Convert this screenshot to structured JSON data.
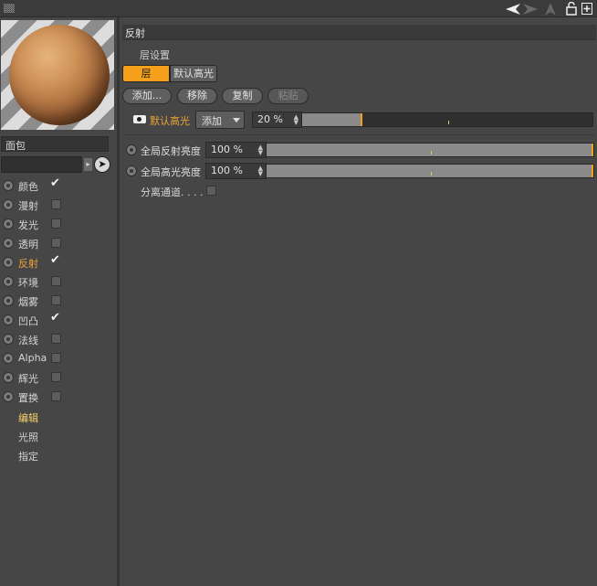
{
  "topbar": {
    "icons": [
      "grip-icon",
      "back-arrow-icon",
      "forward-arrow-icon",
      "up-arrow-icon",
      "lock-icon",
      "new-panel-icon"
    ]
  },
  "left_panel": {
    "material_name": "面包",
    "channels": [
      {
        "label": "颜色",
        "checked": true,
        "active": false
      },
      {
        "label": "漫射",
        "checked": false,
        "active": false
      },
      {
        "label": "发光",
        "checked": false,
        "active": false
      },
      {
        "label": "透明",
        "checked": false,
        "active": false
      },
      {
        "label": "反射",
        "checked": true,
        "active": true
      },
      {
        "label": "环境",
        "checked": false,
        "active": false
      },
      {
        "label": "烟雾",
        "checked": false,
        "active": false
      },
      {
        "label": "凹凸",
        "checked": true,
        "active": false
      },
      {
        "label": "法线",
        "checked": false,
        "active": false
      },
      {
        "label": "Alpha",
        "checked": false,
        "active": false
      },
      {
        "label": "辉光",
        "checked": false,
        "active": false
      },
      {
        "label": "置换",
        "checked": false,
        "active": false
      }
    ],
    "extras": [
      {
        "label": "编辑",
        "highlight": true
      },
      {
        "label": "光照",
        "highlight": false
      },
      {
        "label": "指定",
        "highlight": false
      }
    ],
    "check_mark": "✔"
  },
  "right_panel": {
    "section_title": "反射",
    "layer_settings_label": "层设置",
    "tabs": {
      "active": "层",
      "inactive": "默认高光"
    },
    "buttons": {
      "add": "添加...",
      "remove": "移除",
      "copy": "复制",
      "paste": "粘贴"
    },
    "layer": {
      "name": "默认高光",
      "blend_mode": "添加",
      "opacity": "20 %",
      "opacity_fraction": 0.2
    },
    "global": {
      "reflection_label": "全局反射亮度",
      "reflection_value": "100 %",
      "specular_label": "全局高光亮度",
      "specular_value": "100 %",
      "separate_label": "分离通道. . . ."
    }
  },
  "colors": {
    "accent": "#f7a01b",
    "active_label": "#f0a336",
    "edit_highlight": "#f5d36a"
  }
}
